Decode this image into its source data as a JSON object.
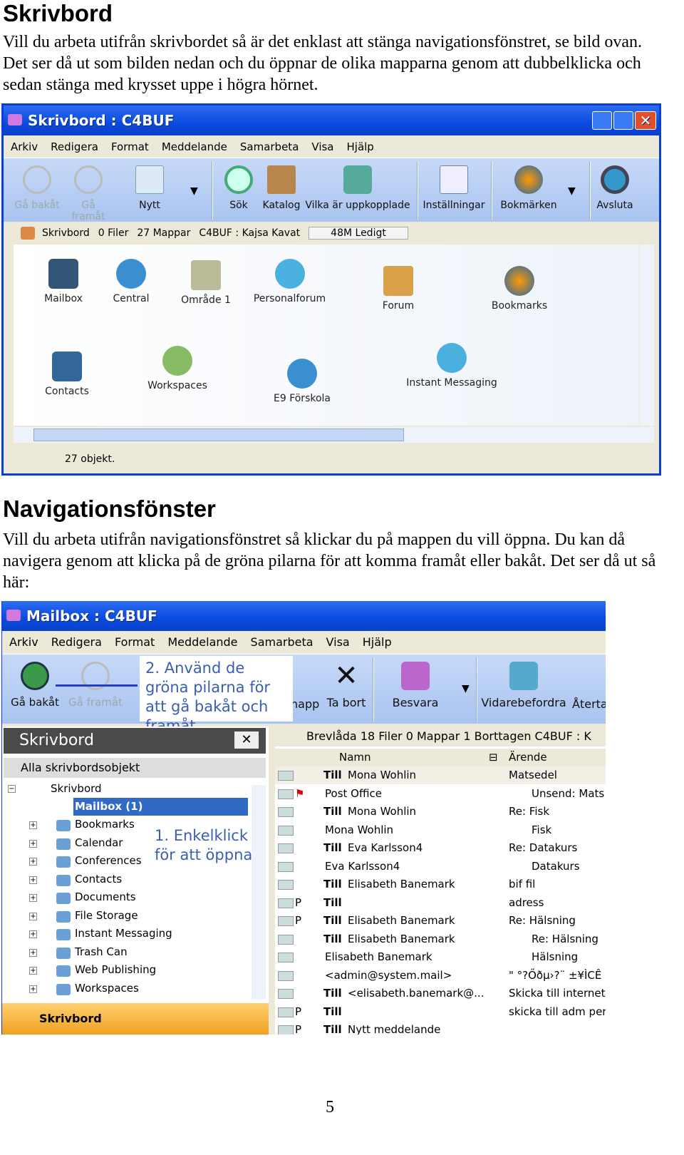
{
  "section1": {
    "heading": "Skrivbord",
    "text": "Vill du arbeta utifrån skrivbordet så är det enklast att stänga navigationsfönstret, se bild ovan. Det ser då ut som bilden nedan och du öppnar de olika mapparna genom att dubbelklicka och sedan stänga med krysset uppe i högra hörnet."
  },
  "win1": {
    "title": "Skrivbord : C4BUF",
    "menu": [
      "Arkiv",
      "Redigera",
      "Format",
      "Meddelande",
      "Samarbeta",
      "Visa",
      "Hjälp"
    ],
    "toolbar": [
      "Gå bakåt",
      "Gå framåt",
      "Nytt",
      "Sök",
      "Katalog",
      "Vilka är uppkopplade",
      "Inställningar",
      "Bokmärken",
      "Avsluta"
    ],
    "address": {
      "name": "Skrivbord",
      "files": "0 Filer",
      "folders": "27 Mappar",
      "user": "C4BUF : Kajsa Kavat",
      "free": "48M Ledigt"
    },
    "items": [
      "Mailbox",
      "Central",
      "Område 1",
      "Personalforum",
      "Forum",
      "Bookmarks",
      "Contacts",
      "Workspaces",
      "E9 Förskola",
      "Instant Messaging"
    ],
    "status": "27 objekt."
  },
  "section2": {
    "heading": "Navigationsfönster",
    "text": "Vill du arbeta utifrån navigationsfönstret så klickar du på mappen du vill öppna. Du kan då navigera genom att klicka på de gröna pilarna för att komma framåt eller bakåt. Det ser då ut så här:"
  },
  "win2": {
    "title": "Mailbox : C4BUF",
    "menu": [
      "Arkiv",
      "Redigera",
      "Format",
      "Meddelande",
      "Samarbeta",
      "Visa",
      "Hjälp"
    ],
    "toolbar": [
      "Gå bakåt",
      "Gå framåt",
      "napp",
      "Ta bort",
      "Besvara",
      "Vidarebefordra",
      "Återta"
    ],
    "callout1": "2. Använd de gröna pilarna för att gå bakåt och framåt",
    "callout2": "1. Enkelklick för att öppna",
    "nav": {
      "header": "Skrivbord",
      "subheader": "Alla skrivbordsobjekt",
      "root": "Skrivbord",
      "selected": "Mailbox (1)",
      "items": [
        "Bookmarks",
        "Calendar",
        "Conferences",
        "Contacts",
        "Documents",
        "File Storage",
        "Instant Messaging",
        "Trash Can",
        "Web Publishing",
        "Workspaces"
      ],
      "footer": "Skrivbord"
    },
    "mail": {
      "header": "Brevlåda   18 Filer  0 Mappar  1 Borttagen   C4BUF : K",
      "col_name": "Namn",
      "col_subject": "Ärende",
      "rows": [
        {
          "to": "Till",
          "name": "Mona Wohlin",
          "subject": "Matsedel",
          "flag": ""
        },
        {
          "to": "",
          "name": "Post Office",
          "subject": "Unsend: Mats",
          "flag": "red"
        },
        {
          "to": "Till",
          "name": "Mona Wohlin",
          "subject": "Re: Fisk",
          "flag": ""
        },
        {
          "to": "",
          "name": "Mona Wohlin",
          "subject": "Fisk",
          "flag": ""
        },
        {
          "to": "Till",
          "name": "Eva Karlsson4",
          "subject": "Re: Datakurs",
          "flag": ""
        },
        {
          "to": "",
          "name": "Eva Karlsson4",
          "subject": "Datakurs",
          "flag": ""
        },
        {
          "to": "Till",
          "name": "Elisabeth Banemark",
          "subject": "bif fil",
          "flag": ""
        },
        {
          "to": "Till",
          "name": "",
          "subject": "adress",
          "flag": "P"
        },
        {
          "to": "Till",
          "name": "Elisabeth Banemark",
          "subject": "Re: Hälsning",
          "flag": "P"
        },
        {
          "to": "Till",
          "name": "Elisabeth Banemark",
          "subject": "Re: Hälsning",
          "flag": ""
        },
        {
          "to": "",
          "name": "Elisabeth Banemark",
          "subject": "Hälsning",
          "flag": ""
        },
        {
          "to": "",
          "name": "<admin@system.mail>",
          "subject": "\" °?Őðµ›?¨ ±¥ÌCÊ",
          "flag": ""
        },
        {
          "to": "Till",
          "name": "<elisabeth.banemark@...",
          "subject": "Skicka till internet",
          "flag": ""
        },
        {
          "to": "Till",
          "name": "",
          "subject": "skicka till adm per",
          "flag": "P"
        },
        {
          "to": "Till",
          "name": "Nytt meddelande",
          "subject": "",
          "flag": "P"
        }
      ]
    }
  },
  "page_number": "5"
}
